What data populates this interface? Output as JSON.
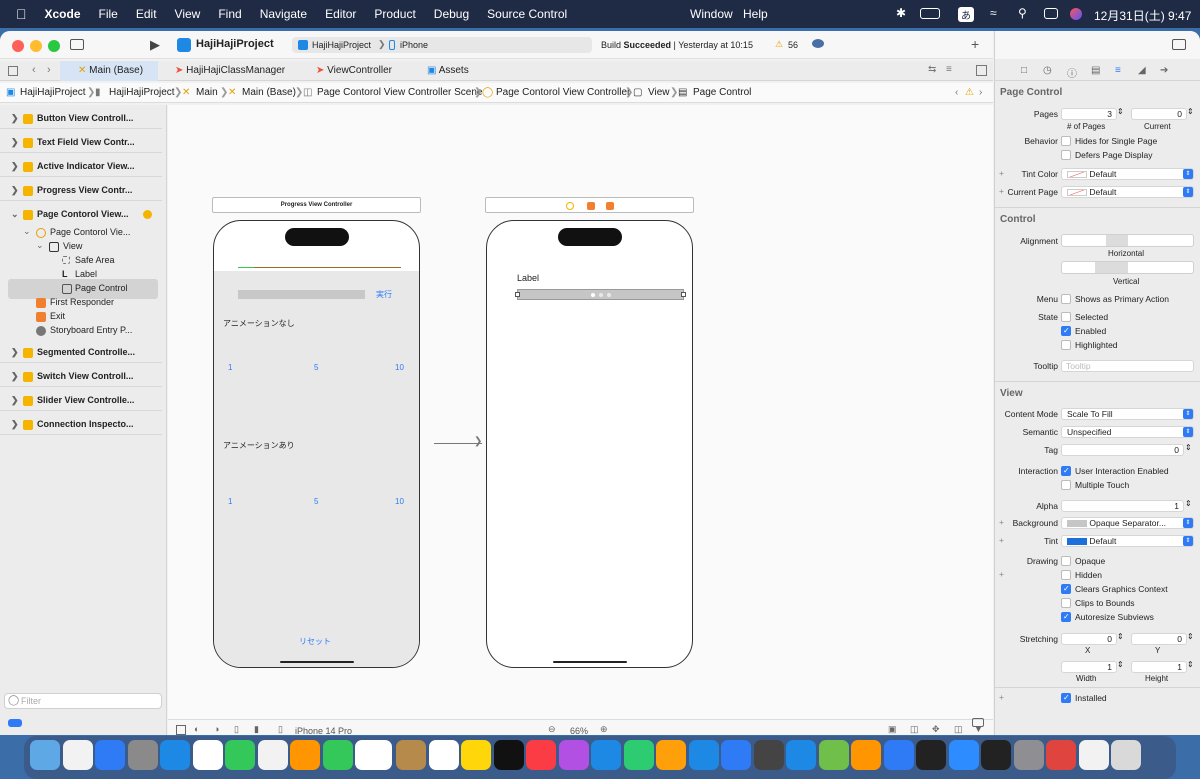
{
  "menubar": {
    "app": "Xcode",
    "items": [
      "File",
      "Edit",
      "View",
      "Find",
      "Navigate",
      "Editor",
      "Product",
      "Debug",
      "Source Control"
    ],
    "window": "Window",
    "help": "Help",
    "ime": "あ",
    "clock": "12月31日(土) 9:47"
  },
  "toolbar": {
    "project": "HajiHajiProject",
    "scheme": "HajiHajiProject",
    "device": "iPhone",
    "status_prefix": "Build ",
    "status_bold": "Succeeded",
    "status_suffix": " | Yesterday at 10:15",
    "warnings": "56"
  },
  "tabs": [
    "Main (Base)",
    "HajiHajiClassManager",
    "ViewController",
    "Assets"
  ],
  "jumpbar": [
    "HajiHajiProject",
    "HajiHajiProject",
    "Main",
    "Main (Base)",
    "Page Contorol View Controller Scene",
    "Page Contorol View Controller",
    "View",
    "Page Control"
  ],
  "navigator": {
    "items": [
      {
        "label": "Button View Controll...",
        "type": "top"
      },
      {
        "label": "Text Field View Contr...",
        "type": "top"
      },
      {
        "label": "Active Indicator View...",
        "type": "top"
      },
      {
        "label": "Progress View Contr...",
        "type": "top"
      },
      {
        "label": "Page Contorol View...",
        "type": "top-open"
      },
      {
        "label": "Page Contorol Vie...",
        "type": "child"
      },
      {
        "label": "View",
        "type": "child2"
      },
      {
        "label": "Safe Area",
        "type": "leaf"
      },
      {
        "label": "Label",
        "type": "leaf"
      },
      {
        "label": "Page Control",
        "type": "leaf-selected"
      },
      {
        "label": "First Responder",
        "type": "child"
      },
      {
        "label": "Exit",
        "type": "child"
      },
      {
        "label": "Storyboard Entry P...",
        "type": "child"
      },
      {
        "label": "Segmented Controlle...",
        "type": "top"
      },
      {
        "label": "Switch View Controll...",
        "type": "top"
      },
      {
        "label": "Slider View Controlle...",
        "type": "top"
      },
      {
        "label": "Connection Inspecto...",
        "type": "top"
      }
    ],
    "filter_placeholder": "Filter"
  },
  "canvas": {
    "scene1_title": "Progress View Controller",
    "run_button": "実行",
    "no_anim": "アニメーションなし",
    "with_anim": "アニメーションあり",
    "slider_min": "1",
    "slider_mid": "5",
    "slider_max": "10",
    "reset": "リセット",
    "label": "Label"
  },
  "bottombar": {
    "device": "iPhone 14 Pro",
    "zoom": "66%"
  },
  "inspector": {
    "page_control_header": "Page Control",
    "pages_label": "Pages",
    "pages_value": "3",
    "current_value": "0",
    "num_pages_caption": "# of Pages",
    "current_caption": "Current",
    "behavior_label": "Behavior",
    "hides_single": "Hides for Single Page",
    "defers_display": "Defers Page Display",
    "tint_color_label": "Tint Color",
    "current_page_label": "Current Page",
    "default": "Default",
    "control_header": "Control",
    "alignment_label": "Alignment",
    "horizontal": "Horizontal",
    "vertical": "Vertical",
    "menu_label": "Menu",
    "primary_action": "Shows as Primary Action",
    "state_label": "State",
    "selected": "Selected",
    "enabled": "Enabled",
    "highlighted": "Highlighted",
    "tooltip_label": "Tooltip",
    "tooltip_placeholder": "Tooltip",
    "view_header": "View",
    "content_mode_label": "Content Mode",
    "content_mode": "Scale To Fill",
    "semantic_label": "Semantic",
    "semantic": "Unspecified",
    "tag_label": "Tag",
    "tag": "0",
    "interaction_label": "Interaction",
    "user_interaction": "User Interaction Enabled",
    "multiple_touch": "Multiple Touch",
    "alpha_label": "Alpha",
    "alpha": "1",
    "background_label": "Background",
    "background": "Opaque Separator...",
    "tint_label": "Tint",
    "drawing_label": "Drawing",
    "opaque": "Opaque",
    "hidden": "Hidden",
    "clears_context": "Clears Graphics Context",
    "clips_bounds": "Clips to Bounds",
    "autoresize": "Autoresize Subviews",
    "stretching_label": "Stretching",
    "x": "X",
    "y": "Y",
    "width": "Width",
    "height": "Height",
    "stretch_x": "0",
    "stretch_y": "0",
    "stretch_w": "1",
    "stretch_h": "1",
    "installed": "Installed"
  },
  "dock": {
    "calendar_day": "31",
    "calendar_month": "12月",
    "colors": [
      "#5fa8e6",
      "#f2f2f2",
      "#2f7bf5",
      "#8a8a8a",
      "#1e88e5",
      "#ffffff",
      "#34c759",
      "#f2f2f2",
      "#ff9500",
      "#34c759",
      "#ffffff",
      "#b58a4a",
      "#ffffff",
      "#ffd60a",
      "#111111",
      "#fc3c44",
      "#b150e2",
      "#1e88e5",
      "#2ecc71",
      "#ff9f0a",
      "#1e88e5",
      "#2f7bf5",
      "#444444",
      "#1e88e5",
      "#6fbf4a",
      "#ff9500",
      "#2f7bf5",
      "#222222",
      "#2d8cff",
      "#222222",
      "#8e8e93",
      "#e0443e",
      "#f2f2f2",
      "#d9d9d9"
    ]
  }
}
